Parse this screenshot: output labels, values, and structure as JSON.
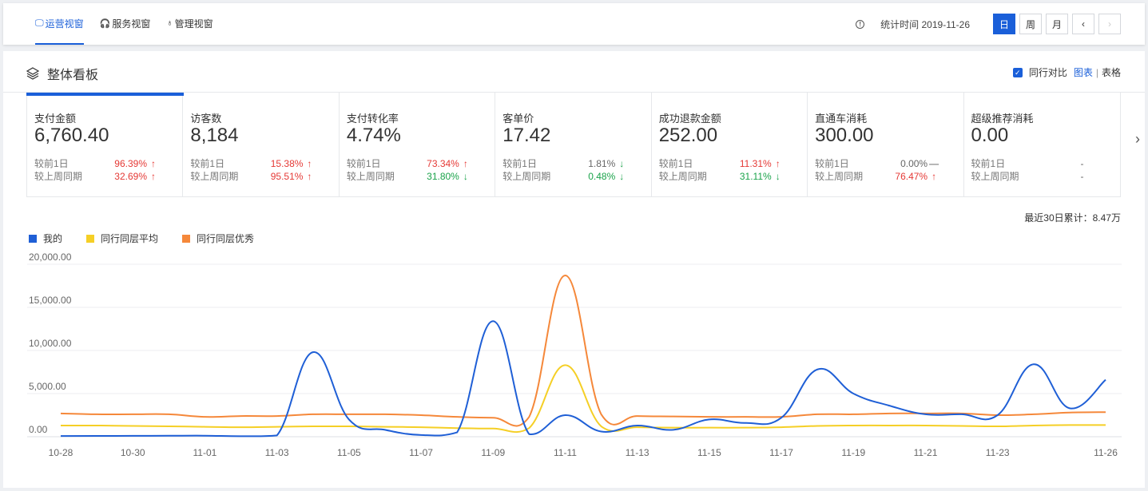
{
  "topbar": {
    "tabs": [
      {
        "label": "运营视窗",
        "icon": "monitor-icon",
        "active": true
      },
      {
        "label": "服务视窗",
        "icon": "headset-icon",
        "active": false
      },
      {
        "label": "管理视窗",
        "icon": "bulb-icon",
        "active": false
      }
    ],
    "stat_time": "统计时间 2019-11-26",
    "period_buttons": [
      "日",
      "周",
      "月"
    ],
    "active_period": "日",
    "prev_icon": "chevron-left-icon",
    "next_icon": "chevron-right-icon"
  },
  "panel": {
    "title": "整体看板",
    "title_icon": "layers-icon",
    "compare_label": "同行对比",
    "compare_checked": true,
    "view_chart": "图表",
    "view_sep": "|",
    "view_table": "表格"
  },
  "kpis": [
    {
      "label": "支付金额",
      "value": "6,760.40",
      "d1_label": "较前1日",
      "d1": "96.39%",
      "d1_trend": "up",
      "w_label": "较上周同期",
      "w": "32.69%",
      "w_trend": "up",
      "active": true
    },
    {
      "label": "访客数",
      "value": "8,184",
      "d1_label": "较前1日",
      "d1": "15.38%",
      "d1_trend": "up",
      "w_label": "较上周同期",
      "w": "95.51%",
      "w_trend": "up"
    },
    {
      "label": "支付转化率",
      "value": "4.74%",
      "d1_label": "较前1日",
      "d1": "73.34%",
      "d1_trend": "up",
      "w_label": "较上周同期",
      "w": "31.80%",
      "w_trend": "down"
    },
    {
      "label": "客单价",
      "value": "17.42",
      "d1_label": "较前1日",
      "d1": "1.81%",
      "d1_trend": "down",
      "w_label": "较上周同期",
      "w": "0.48%",
      "w_trend": "down"
    },
    {
      "label": "成功退款金额",
      "value": "252.00",
      "d1_label": "较前1日",
      "d1": "11.31%",
      "d1_trend": "up",
      "w_label": "较上周同期",
      "w": "31.11%",
      "w_trend": "down"
    },
    {
      "label": "直通车消耗",
      "value": "300.00",
      "d1_label": "较前1日",
      "d1": "0.00%",
      "d1_trend": "flat",
      "w_label": "较上周同期",
      "w": "76.47%",
      "w_trend": "up"
    },
    {
      "label": "超级推荐消耗",
      "value": "0.00",
      "d1_label": "较前1日",
      "d1": "-",
      "d1_trend": "none",
      "w_label": "较上周同期",
      "w": "-",
      "w_trend": "none"
    }
  ],
  "summary": "最近30日累计：8.47万",
  "colors": {
    "mine": "#1f5fd6",
    "avg": "#f5cf26",
    "best": "#f5883a",
    "up": "#e53935",
    "down": "#1aa34a",
    "accent": "#1a5fd9"
  },
  "chart_data": {
    "type": "line",
    "x": [
      "10-28",
      "10-29",
      "10-30",
      "10-31",
      "11-01",
      "11-02",
      "11-03",
      "11-04",
      "11-05",
      "11-06",
      "11-07",
      "11-08",
      "11-09",
      "11-10",
      "11-11",
      "11-12",
      "11-13",
      "11-14",
      "11-15",
      "11-16",
      "11-17",
      "11-18",
      "11-19",
      "11-20",
      "11-21",
      "11-22",
      "11-23",
      "11-24",
      "11-25",
      "11-26"
    ],
    "x_tick_labels": [
      "10-28",
      "10-30",
      "11-01",
      "11-03",
      "11-05",
      "11-07",
      "11-09",
      "11-11",
      "11-13",
      "11-15",
      "11-17",
      "11-19",
      "11-21",
      "11-23",
      "11-26"
    ],
    "y_ticks": [
      "0.00",
      "5,000.00",
      "10,000.00",
      "15,000.00",
      "20,000.00"
    ],
    "ylim": [
      0,
      20000
    ],
    "grid": true,
    "legend_position": "top-left",
    "series": [
      {
        "name": "我的",
        "values": [
          80,
          90,
          100,
          110,
          120,
          60,
          150,
          9800,
          2000,
          800,
          200,
          500,
          13400,
          300,
          2500,
          600,
          1300,
          800,
          2000,
          1600,
          2200,
          7800,
          5000,
          3600,
          2600,
          2600,
          2500,
          8400,
          3300,
          6600
        ]
      },
      {
        "name": "同行同层平均",
        "values": [
          1300,
          1300,
          1250,
          1200,
          1150,
          1100,
          1150,
          1200,
          1200,
          1150,
          1100,
          1000,
          950,
          1000,
          8300,
          1200,
          1100,
          1050,
          1050,
          1050,
          1100,
          1250,
          1300,
          1300,
          1300,
          1250,
          1200,
          1300,
          1350,
          1350
        ]
      },
      {
        "name": "同行同层优秀",
        "values": [
          2700,
          2600,
          2600,
          2600,
          2300,
          2400,
          2400,
          2600,
          2600,
          2600,
          2500,
          2300,
          2200,
          2300,
          18700,
          2600,
          2400,
          2350,
          2300,
          2300,
          2300,
          2600,
          2600,
          2700,
          2700,
          2700,
          2500,
          2600,
          2800,
          2850
        ]
      }
    ]
  }
}
